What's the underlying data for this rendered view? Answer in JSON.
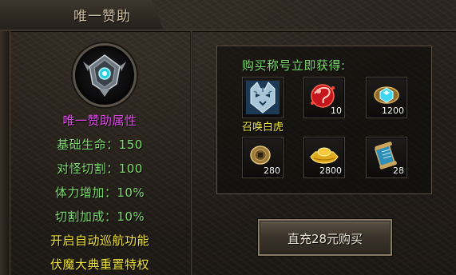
{
  "window": {
    "title": "唯一赞助"
  },
  "left": {
    "emblem_icon": "silver-crest-icon",
    "attr_title": "唯一赞助属性",
    "attributes": [
      "基础生命：150",
      "对怪切割：100",
      "体力增加：10%",
      "切割加成：10%"
    ],
    "features": [
      "开启自动巡航功能",
      "伏魔大典重置特权"
    ],
    "colors": {
      "title": "#e64df0",
      "attributes": "#7fdc6e",
      "features": "#f0e33a"
    }
  },
  "rewards": {
    "header": "购买称号立即获得:",
    "items": [
      {
        "icon": "tiger-summon-icon",
        "name": "召唤白虎",
        "count": ""
      },
      {
        "icon": "red-orb-icon",
        "name": "",
        "count": "10"
      },
      {
        "icon": "blue-gem-icon",
        "name": "",
        "count": "1200"
      },
      {
        "icon": "gold-coin-icon",
        "name": "",
        "count": "280"
      },
      {
        "icon": "gold-ingot-icon",
        "name": "",
        "count": "2800"
      },
      {
        "icon": "scroll-icon",
        "name": "",
        "count": "28"
      }
    ]
  },
  "buy_button": {
    "label": "直充28元购买"
  }
}
